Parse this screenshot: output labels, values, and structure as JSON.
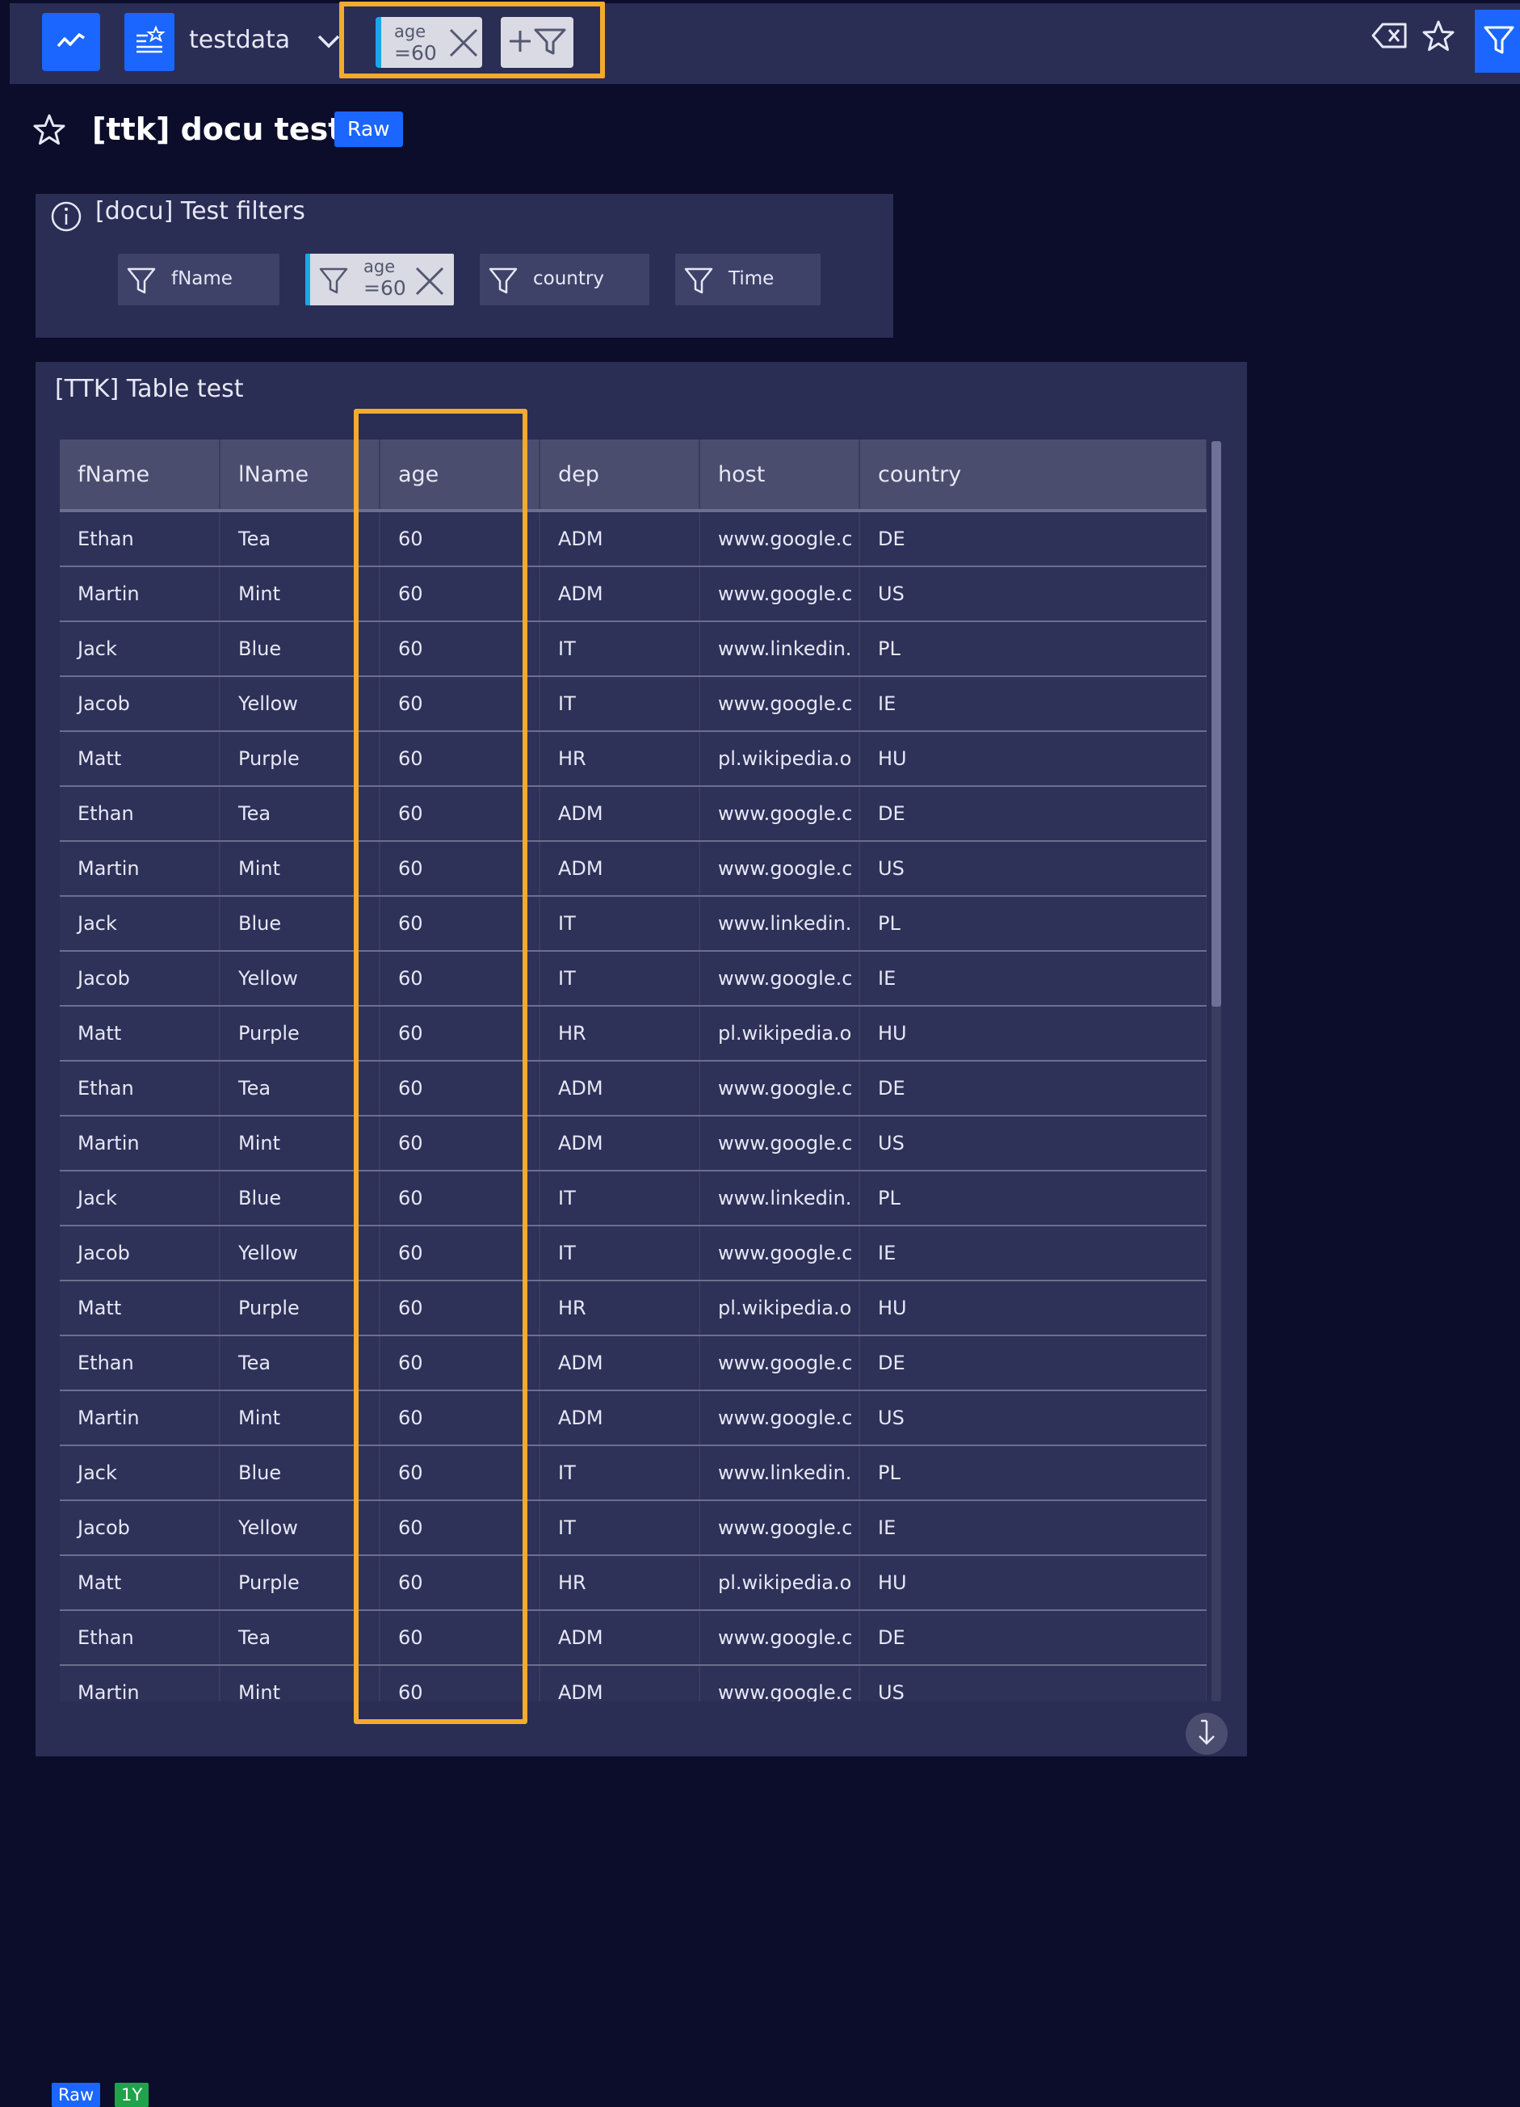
{
  "topbar": {
    "datasource_name": "testdata",
    "active_filter": {
      "key": "age",
      "value": "=60"
    },
    "icons": [
      "trend-line-icon",
      "dashboard-icon",
      "chevron-down-icon",
      "close-icon",
      "add-filter-icon",
      "clear-filters-icon",
      "star-icon",
      "filter-icon"
    ]
  },
  "page": {
    "title": "[ttk] docu test",
    "badge": "Raw"
  },
  "filter_panel": {
    "title": "[docu] Test filters",
    "chips": [
      {
        "label": "fName"
      },
      {
        "key": "age",
        "value": "=60",
        "active": true
      },
      {
        "label": "country"
      },
      {
        "label": "Time"
      }
    ]
  },
  "table_widget": {
    "title": "[TTK] Table test",
    "columns": [
      "fName",
      "lName",
      "age",
      "dep",
      "host",
      "country"
    ],
    "rows": [
      [
        "Ethan",
        "Tea",
        "60",
        "ADM",
        "www.google.c",
        "DE"
      ],
      [
        "Martin",
        "Mint",
        "60",
        "ADM",
        "www.google.c",
        "US"
      ],
      [
        "Jack",
        "Blue",
        "60",
        "IT",
        "www.linkedin.",
        "PL"
      ],
      [
        "Jacob",
        "Yellow",
        "60",
        "IT",
        "www.google.c",
        "IE"
      ],
      [
        "Matt",
        "Purple",
        "60",
        "HR",
        "pl.wikipedia.o",
        "HU"
      ],
      [
        "Ethan",
        "Tea",
        "60",
        "ADM",
        "www.google.c",
        "DE"
      ],
      [
        "Martin",
        "Mint",
        "60",
        "ADM",
        "www.google.c",
        "US"
      ],
      [
        "Jack",
        "Blue",
        "60",
        "IT",
        "www.linkedin.",
        "PL"
      ],
      [
        "Jacob",
        "Yellow",
        "60",
        "IT",
        "www.google.c",
        "IE"
      ],
      [
        "Matt",
        "Purple",
        "60",
        "HR",
        "pl.wikipedia.o",
        "HU"
      ],
      [
        "Ethan",
        "Tea",
        "60",
        "ADM",
        "www.google.c",
        "DE"
      ],
      [
        "Martin",
        "Mint",
        "60",
        "ADM",
        "www.google.c",
        "US"
      ],
      [
        "Jack",
        "Blue",
        "60",
        "IT",
        "www.linkedin.",
        "PL"
      ],
      [
        "Jacob",
        "Yellow",
        "60",
        "IT",
        "www.google.c",
        "IE"
      ],
      [
        "Matt",
        "Purple",
        "60",
        "HR",
        "pl.wikipedia.o",
        "HU"
      ],
      [
        "Ethan",
        "Tea",
        "60",
        "ADM",
        "www.google.c",
        "DE"
      ],
      [
        "Martin",
        "Mint",
        "60",
        "ADM",
        "www.google.c",
        "US"
      ],
      [
        "Jack",
        "Blue",
        "60",
        "IT",
        "www.linkedin.",
        "PL"
      ],
      [
        "Jacob",
        "Yellow",
        "60",
        "IT",
        "www.google.c",
        "IE"
      ],
      [
        "Matt",
        "Purple",
        "60",
        "HR",
        "pl.wikipedia.o",
        "HU"
      ],
      [
        "Ethan",
        "Tea",
        "60",
        "ADM",
        "www.google.c",
        "DE"
      ],
      [
        "Martin",
        "Mint",
        "60",
        "ADM",
        "www.google.c",
        "US"
      ]
    ],
    "footer_badges": [
      {
        "label": "Raw",
        "color": "#1a66ff"
      },
      {
        "label": "1Y",
        "color": "#1fa34a"
      }
    ]
  },
  "colors": {
    "accent": "#1a66ff",
    "highlight": "#f2ab2e",
    "background": "#0b0d2a",
    "panel": "#2a2d54",
    "active_chip_bar": "#1aa7e8"
  }
}
